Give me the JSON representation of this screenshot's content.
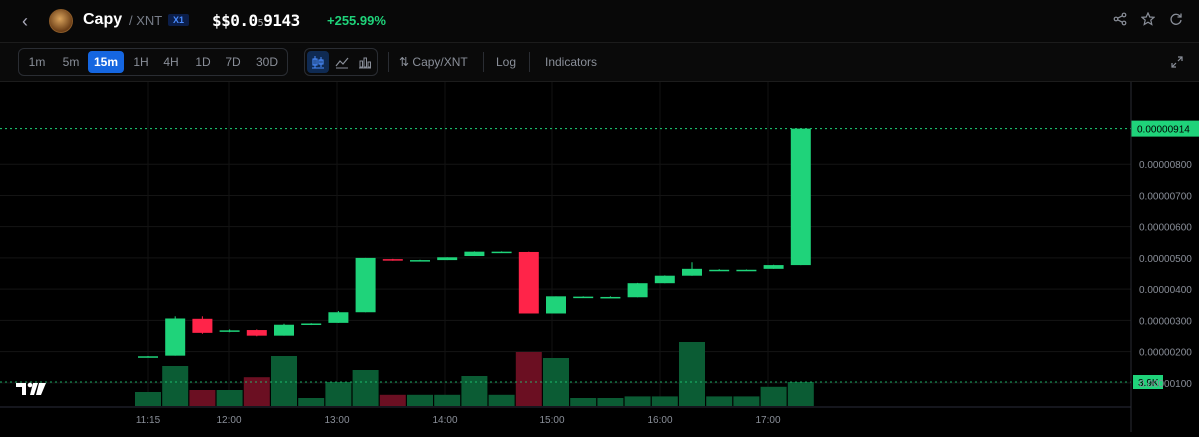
{
  "header": {
    "symbol": "Capy",
    "quote": "XNT",
    "pair_sep": "/",
    "badge": "X1",
    "price_prefix": "$$0.0",
    "price_zeros": "5",
    "price_digits": "9143",
    "change": "+255.99%"
  },
  "toolbar": {
    "timeframes": [
      "1m",
      "5m",
      "15m",
      "1H",
      "4H",
      "1D",
      "7D",
      "30D"
    ],
    "active_timeframe": "15m",
    "pair_toggle": "Capy/XNT",
    "log_label": "Log",
    "indicators_label": "Indicators"
  },
  "colors": {
    "up": "#1fd37a",
    "down": "#ff2449",
    "accent": "#1566e0",
    "bg": "#000000"
  },
  "chart_data": {
    "type": "candlestick",
    "x_tick_labels": [
      "11:15",
      "12:00",
      "13:00",
      "14:00",
      "15:00",
      "16:00",
      "17:00"
    ],
    "y_tick_labels": [
      "0.00000800",
      "0.00000700",
      "0.00000600",
      "0.00000500",
      "0.00000400",
      "0.00000300",
      "0.00000200",
      "0.00000100"
    ],
    "last_price_label": "0.00000914",
    "volume_label": "3.9K",
    "ylim": [
      4.5e-07,
      9.8e-06
    ],
    "candles": [
      {
        "o": 1.84e-06,
        "h": 1.86e-06,
        "l": 1.83e-06,
        "c": 1.85e-06
      },
      {
        "o": 1.87e-06,
        "h": 3.13e-06,
        "l": 1.87e-06,
        "c": 3.06e-06
      },
      {
        "o": 3.05e-06,
        "h": 3.13e-06,
        "l": 2.57e-06,
        "c": 2.6e-06
      },
      {
        "o": 2.64e-06,
        "h": 2.71e-06,
        "l": 2.62e-06,
        "c": 2.68e-06
      },
      {
        "o": 2.69e-06,
        "h": 2.71e-06,
        "l": 2.49e-06,
        "c": 2.51e-06
      },
      {
        "o": 2.51e-06,
        "h": 2.89e-06,
        "l": 2.51e-06,
        "c": 2.86e-06
      },
      {
        "o": 2.86e-06,
        "h": 2.91e-06,
        "l": 2.85e-06,
        "c": 2.9e-06
      },
      {
        "o": 2.92e-06,
        "h": 3.3e-06,
        "l": 2.92e-06,
        "c": 3.26e-06
      },
      {
        "o": 3.26e-06,
        "h": 5e-06,
        "l": 3.26e-06,
        "c": 5e-06
      },
      {
        "o": 4.96e-06,
        "h": 4.97e-06,
        "l": 4.91e-06,
        "c": 4.92e-06
      },
      {
        "o": 4.9e-06,
        "h": 4.94e-06,
        "l": 4.89e-06,
        "c": 4.93e-06
      },
      {
        "o": 4.93e-06,
        "h": 5.02e-06,
        "l": 4.93e-06,
        "c": 5.02e-06
      },
      {
        "o": 5.06e-06,
        "h": 5.21e-06,
        "l": 5.06e-06,
        "c": 5.2e-06
      },
      {
        "o": 5.2e-06,
        "h": 5.21e-06,
        "l": 5.19e-06,
        "c": 5.2e-06
      },
      {
        "o": 5.19e-06,
        "h": 5.2e-06,
        "l": 3.22e-06,
        "c": 3.22e-06
      },
      {
        "o": 3.22e-06,
        "h": 3.77e-06,
        "l": 3.22e-06,
        "c": 3.77e-06
      },
      {
        "o": 3.74e-06,
        "h": 3.77e-06,
        "l": 3.73e-06,
        "c": 3.76e-06
      },
      {
        "o": 3.74e-06,
        "h": 3.77e-06,
        "l": 3.72e-06,
        "c": 3.75e-06
      },
      {
        "o": 3.74e-06,
        "h": 4.2e-06,
        "l": 3.74e-06,
        "c": 4.19e-06
      },
      {
        "o": 4.19e-06,
        "h": 4.44e-06,
        "l": 4.19e-06,
        "c": 4.43e-06
      },
      {
        "o": 4.43e-06,
        "h": 4.86e-06,
        "l": 4.43e-06,
        "c": 4.65e-06
      },
      {
        "o": 4.61e-06,
        "h": 4.64e-06,
        "l": 4.6e-06,
        "c": 4.62e-06
      },
      {
        "o": 4.61e-06,
        "h": 4.63e-06,
        "l": 4.6e-06,
        "c": 4.62e-06
      },
      {
        "o": 4.65e-06,
        "h": 4.78e-06,
        "l": 4.65e-06,
        "c": 4.77e-06
      },
      {
        "o": 4.77e-06,
        "h": 9.14e-06,
        "l": 4.77e-06,
        "c": 9.14e-06
      }
    ],
    "volumes": [
      0.35,
      1.0,
      0.4,
      0.4,
      0.72,
      1.25,
      0.2,
      0.6,
      0.9,
      0.28,
      0.28,
      0.28,
      0.75,
      0.28,
      1.35,
      1.2,
      0.2,
      0.2,
      0.24,
      0.24,
      1.6,
      0.24,
      0.24,
      0.48,
      0.6
    ]
  }
}
